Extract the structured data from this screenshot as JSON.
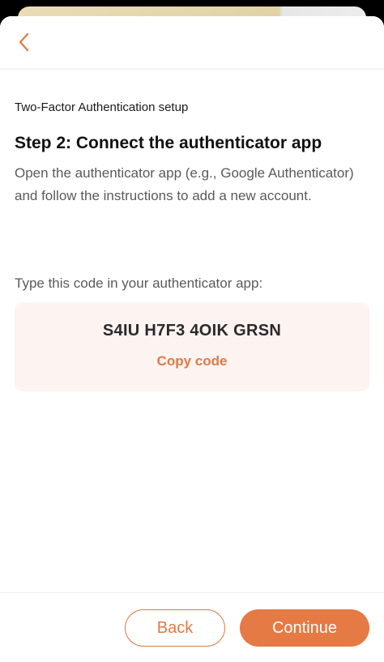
{
  "header": {
    "back_icon": "chevron-left-icon"
  },
  "page": {
    "setup_title": "Two-Factor Authentication setup",
    "step_title": "Step 2: Connect the authenticator app",
    "step_description": "Open the authenticator app (e.g., Google Authenticator) and follow the instructions to add a new account.",
    "code_label": "Type this code in your authenticator app:",
    "code": "S4IU H7F3 4OIK GRSN",
    "copy_label": "Copy code"
  },
  "footer": {
    "back_label": "Back",
    "continue_label": "Continue"
  },
  "colors": {
    "accent": "#e57a44",
    "code_box_bg": "#fdf3f1"
  }
}
